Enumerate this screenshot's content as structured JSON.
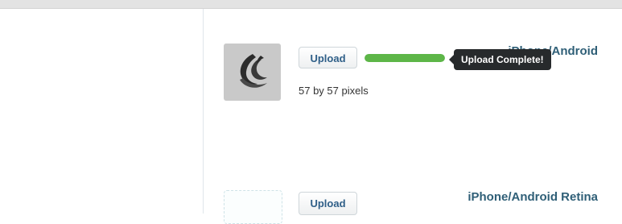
{
  "rows": [
    {
      "label": "iPhone/Android",
      "upload_label": "Upload",
      "progress": 1.0,
      "tooltip": "Upload Complete!",
      "dimensions": "57 by 57 pixels",
      "thumbnail_icon": "swoosh-logo-icon"
    },
    {
      "label": "iPhone/Android Retina",
      "upload_label": "Upload"
    }
  ],
  "colors": {
    "label": "#2f5f77",
    "progress_fill": "#5db648",
    "tooltip_bg": "#272a2c",
    "button_text": "#2f5f88"
  }
}
